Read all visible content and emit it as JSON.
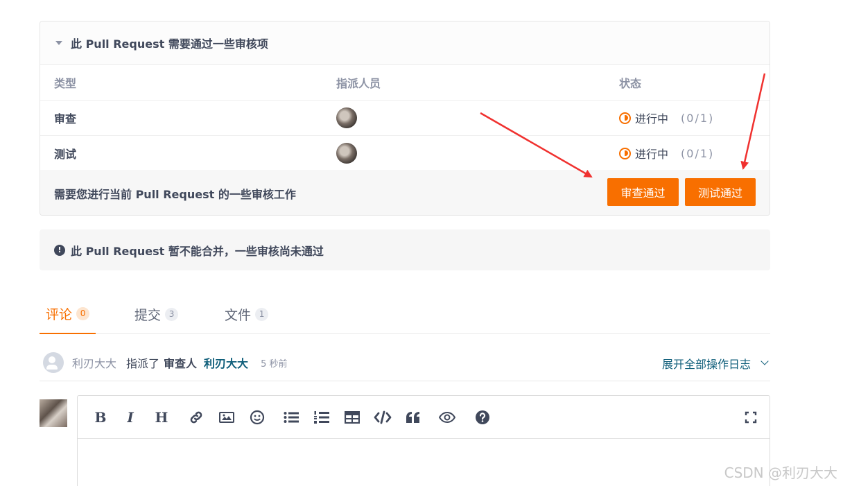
{
  "review": {
    "header": "此 Pull Request 需要通过一些审核项",
    "columns": {
      "type": "类型",
      "assignee": "指派人员",
      "status": "状态"
    },
    "rows": [
      {
        "type": "审查",
        "status": "进行中",
        "count": "(0/1)"
      },
      {
        "type": "测试",
        "status": "进行中",
        "count": "(0/1)"
      }
    ],
    "action_text": "需要您进行当前 Pull Request 的一些审核工作",
    "approve_review_label": "审查通过",
    "approve_test_label": "测试通过"
  },
  "merge_notice": "此 Pull Request 暂不能合并，一些审核尚未通过",
  "tabs": [
    {
      "label": "评论",
      "count": "0",
      "active": true
    },
    {
      "label": "提交",
      "count": "3",
      "active": false
    },
    {
      "label": "文件",
      "count": "1",
      "active": false
    }
  ],
  "log": {
    "user": "利刃大大",
    "verb": "指派了",
    "role": "审查人",
    "target": "利刃大大",
    "time": "5 秒前",
    "expand_label": "展开全部操作日志"
  },
  "editor": {
    "tools": [
      "bold-icon",
      "italic-icon",
      "heading-icon",
      "link-icon",
      "image-icon",
      "emoji-icon",
      "bullet-list-icon",
      "numbered-list-icon",
      "table-icon",
      "code-icon",
      "quote-icon",
      "preview-icon",
      "help-icon",
      "fullscreen-icon"
    ],
    "bold_glyph": "B",
    "italic_glyph": "I",
    "heading_glyph": "H"
  },
  "watermark": "CSDN @利刃大大",
  "colors": {
    "accent": "#f86f00",
    "link": "#0f5e7a",
    "text": "#40485b",
    "muted": "#8c92a4",
    "annotation_arrow": "#f0312f"
  }
}
